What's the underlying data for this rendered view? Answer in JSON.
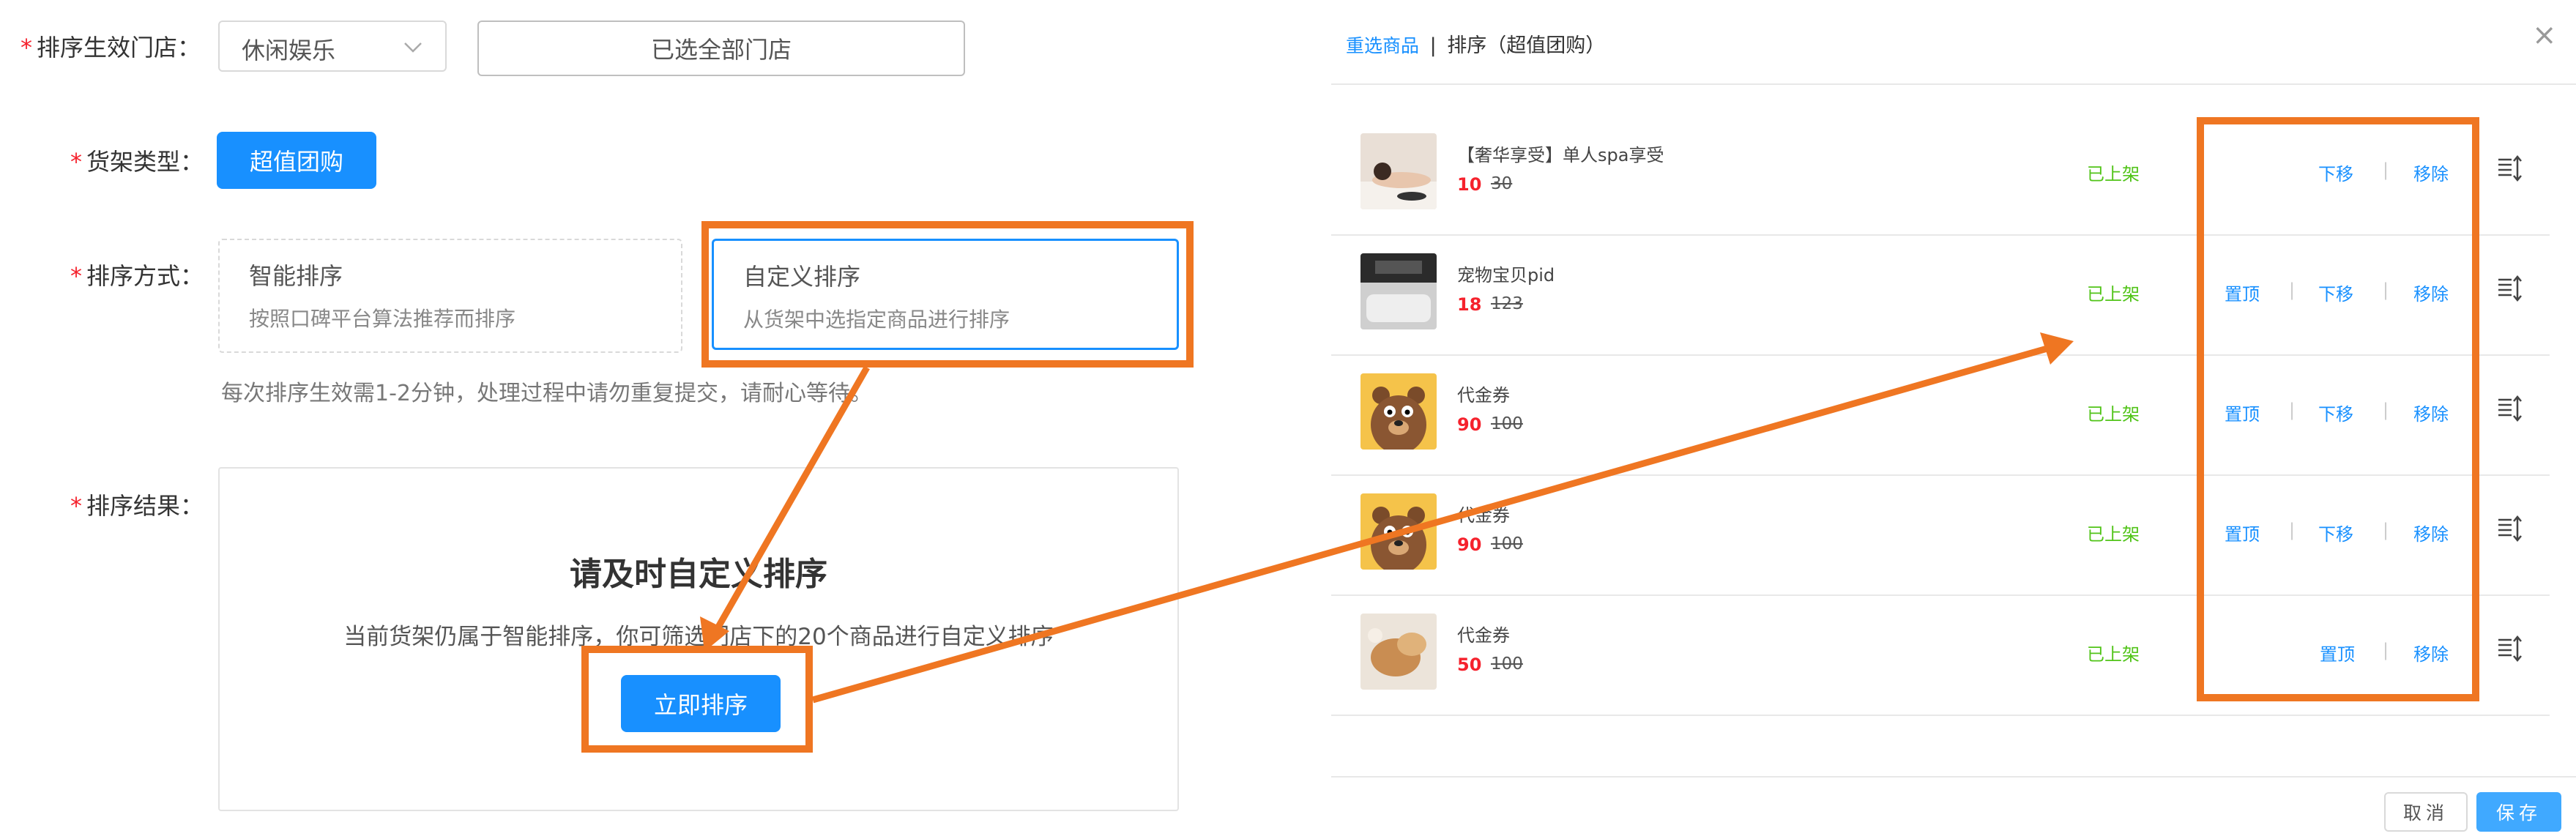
{
  "form": {
    "store_label": "排序生效门店：",
    "store_value": "休闲娱乐",
    "store_all_button": "已选全部门店",
    "shelf_label": "货架类型：",
    "shelf_button": "超值团购",
    "sort_label": "排序方式：",
    "smart": {
      "title": "智能排序",
      "desc": "按照口碑平台算法推荐而排序"
    },
    "custom": {
      "title": "自定义排序",
      "desc": "从货架中选指定商品进行排序"
    },
    "hint": "每次排序生效需1-2分钟，处理过程中请勿重复提交，请耐心等待。",
    "result_label": "排序结果：",
    "result_title": "请及时自定义排序",
    "result_desc": "当前货架仍属于智能排序，你可筛选门店下的20个商品进行自定义排序",
    "result_button": "立即排序"
  },
  "panel": {
    "reselect_link": "重选商品",
    "separator": "|",
    "title": "排序（超值团购）",
    "close": "×",
    "items": [
      {
        "name": "【奢华享受】单人spa享受",
        "price": "10",
        "original": "30",
        "status": "已上架",
        "top": "",
        "down": "下移",
        "remove": "移除",
        "thumb_icon": "spa-thumbnail"
      },
      {
        "name": "宠物宝贝pid",
        "price": "18",
        "original": "123",
        "status": "已上架",
        "top": "置顶",
        "down": "下移",
        "remove": "移除",
        "thumb_icon": "pet-thumbnail"
      },
      {
        "name": "代金券",
        "price": "90",
        "original": "100",
        "status": "已上架",
        "top": "置顶",
        "down": "下移",
        "remove": "移除",
        "thumb_icon": "bear-thumbnail"
      },
      {
        "name": "代金券",
        "price": "90",
        "original": "100",
        "status": "已上架",
        "top": "置顶",
        "down": "下移",
        "remove": "移除",
        "thumb_icon": "bear-thumbnail"
      },
      {
        "name": "代金券",
        "price": "50",
        "original": "100",
        "status": "已上架",
        "top": "置顶",
        "down": "",
        "remove": "移除",
        "thumb_icon": "food-thumbnail"
      }
    ],
    "cancel": "取消",
    "save": "保存"
  },
  "colors": {
    "accent": "#1890ff",
    "annotation": "#ef7622",
    "price": "#f5222d",
    "status": "#52c41a"
  }
}
